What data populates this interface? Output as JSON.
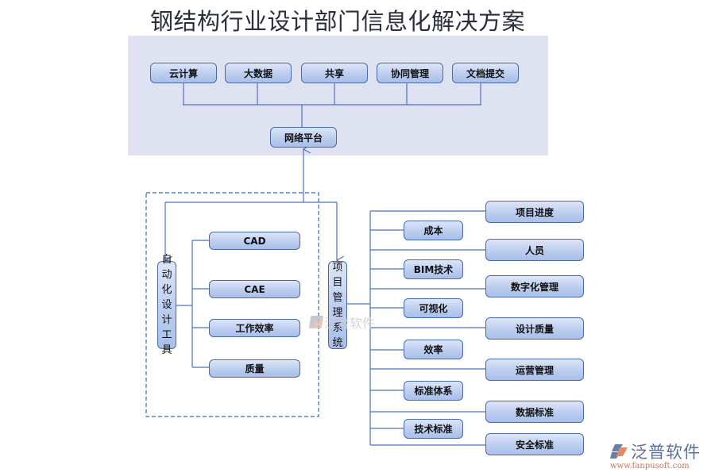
{
  "title": "钢结构行业设计部门信息化解决方案",
  "top_section": {
    "services": [
      "云计算",
      "大数据",
      "共享",
      "协同管理",
      "文档提交"
    ],
    "platform": "网络平台"
  },
  "left_group": {
    "vertical_label": [
      "自",
      "动",
      "化",
      "设",
      "计",
      "工",
      "具"
    ],
    "items": [
      "CAD",
      "CAE",
      "工作效率",
      "质量"
    ]
  },
  "center": {
    "vertical_label": [
      "项",
      "目",
      "管",
      "理",
      "系",
      "统"
    ]
  },
  "right_branches": {
    "inner_items": [
      "成本",
      "BIM技术",
      "可视化",
      "效率",
      "标准体系",
      "技术标准"
    ],
    "outer_items": [
      "项目进度",
      "人员",
      "数字化管理",
      "设计质量",
      "运营管理",
      "数据标准",
      "安全标准"
    ]
  },
  "watermark": "泛普软件",
  "logo": {
    "name": "泛普软件",
    "url": "www.fanpusoft.com"
  },
  "colors": {
    "line": "#4a72c4",
    "node_border": "#4a6ba8",
    "panel_bg": "#dfe3f1",
    "dashed": "#3f67b3"
  }
}
